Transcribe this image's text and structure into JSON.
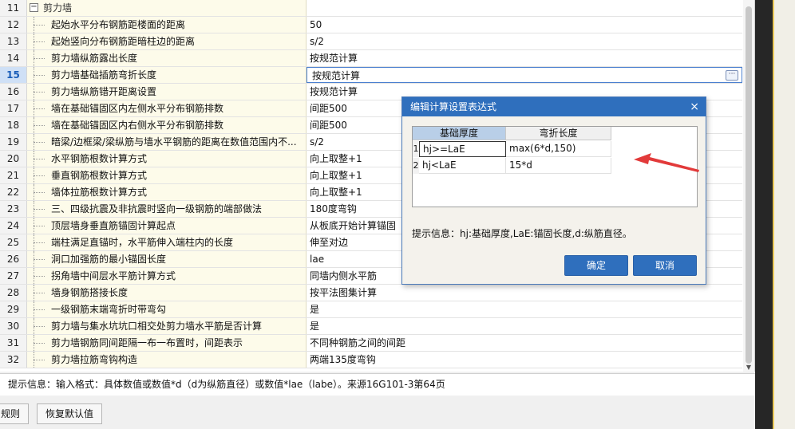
{
  "group": {
    "number": "11",
    "title": "剪力墙"
  },
  "rows": [
    {
      "num": "12",
      "name": "起始水平分布钢筋距楼面的距离",
      "value": "50"
    },
    {
      "num": "13",
      "name": "起始竖向分布钢筋距暗柱边的距离",
      "value": "s/2"
    },
    {
      "num": "14",
      "name": "剪力墙纵筋露出长度",
      "value": "按规范计算"
    },
    {
      "num": "15",
      "name": "剪力墙基础插筋弯折长度",
      "value": "按规范计算"
    },
    {
      "num": "16",
      "name": "剪力墙纵筋错开距离设置",
      "value": "按规范计算"
    },
    {
      "num": "17",
      "name": "墙在基础锚固区内左侧水平分布钢筋排数",
      "value": "间距500"
    },
    {
      "num": "18",
      "name": "墙在基础锚固区内右侧水平分布钢筋排数",
      "value": "间距500"
    },
    {
      "num": "19",
      "name": "暗梁/边框梁/梁纵筋与墙水平钢筋的距离在数值范围内不...",
      "value": "s/2"
    },
    {
      "num": "20",
      "name": "水平钢筋根数计算方式",
      "value": "向上取整+1"
    },
    {
      "num": "21",
      "name": "垂直钢筋根数计算方式",
      "value": "向上取整+1"
    },
    {
      "num": "22",
      "name": "墙体拉筋根数计算方式",
      "value": "向上取整+1"
    },
    {
      "num": "23",
      "name": "三、四级抗震及非抗震时竖向一级钢筋的端部做法",
      "value": "180度弯钩"
    },
    {
      "num": "24",
      "name": "顶层墙身垂直筋锚固计算起点",
      "value": "从板底开始计算锚固"
    },
    {
      "num": "25",
      "name": "端柱满足直锚时，水平筋伸入端柱内的长度",
      "value": "伸至对边"
    },
    {
      "num": "26",
      "name": "洞口加强筋的最小锚固长度",
      "value": "lae"
    },
    {
      "num": "27",
      "name": "拐角墙中间层水平筋计算方式",
      "value": "同墙内侧水平筋"
    },
    {
      "num": "28",
      "name": "墙身钢筋搭接长度",
      "value": "按平法图集计算"
    },
    {
      "num": "29",
      "name": "一级钢筋末端弯折时带弯勾",
      "value": "是"
    },
    {
      "num": "30",
      "name": "剪力墙与集水坑坑口相交处剪力墙水平筋是否计算",
      "value": "是"
    },
    {
      "num": "31",
      "name": "剪力墙钢筋同间距隔一布一布置时，间距表示",
      "value": "不同种钢筋之间的间距"
    },
    {
      "num": "32",
      "name": "剪力墙拉筋弯钩构造",
      "value": "两端135度弯钩"
    }
  ],
  "active_row": "15",
  "hint": "提示信息：输入格式：具体数值或数值*d（d为纵筋直径）或数值*lae（labe）。来源16G101-3第64页",
  "bottom_buttons": {
    "rules": "规则",
    "restore": "恢复默认值"
  },
  "dialog": {
    "title": "编辑计算设置表达式",
    "close_glyph": "×",
    "columns": [
      "基础厚度",
      "弯折长度"
    ],
    "entries": [
      {
        "num": "1",
        "thickness": "hj>=LaE",
        "bend": "max(6*d,150)"
      },
      {
        "num": "2",
        "thickness": "hj<LaE",
        "bend": "15*d"
      }
    ],
    "hint": "提示信息：hj:基础厚度,LaE:锚固长度,d:纵筋直径。",
    "ok": "确定",
    "cancel": "取消"
  },
  "colors": {
    "accent": "#2f6fbd",
    "arrow": "#e23a3a",
    "name_bg": "#fdfbea"
  },
  "icons": {
    "expander": "minus-box-icon",
    "ellipsis": "ellipsis-icon",
    "close": "close-icon"
  }
}
